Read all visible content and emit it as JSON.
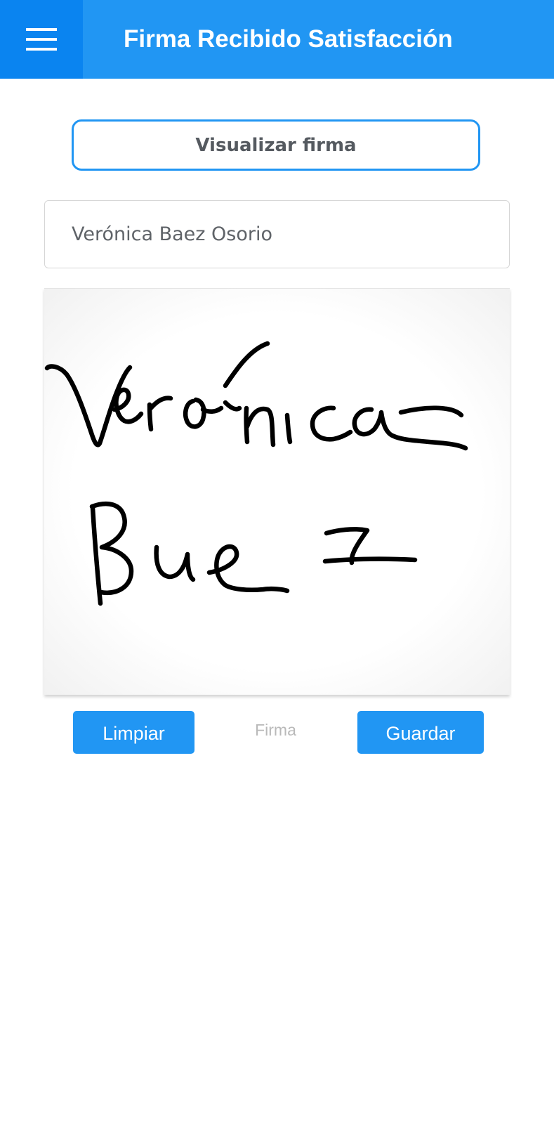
{
  "header": {
    "title": "Firma Recibido Satisfacción",
    "menu_icon": "hamburger-menu-icon",
    "background": "#2196f3",
    "menu_background": "#0a84f0"
  },
  "view_signature_button": {
    "label": "Visualizar firma"
  },
  "name_field": {
    "value": "Verónica Baez Osorio"
  },
  "signature_pad": {
    "signature_text": "Verónica Baez",
    "caption": "Firma"
  },
  "actions": {
    "clear_label": "Limpiar",
    "save_label": "Guardar",
    "accent_color": "#2196f3"
  }
}
